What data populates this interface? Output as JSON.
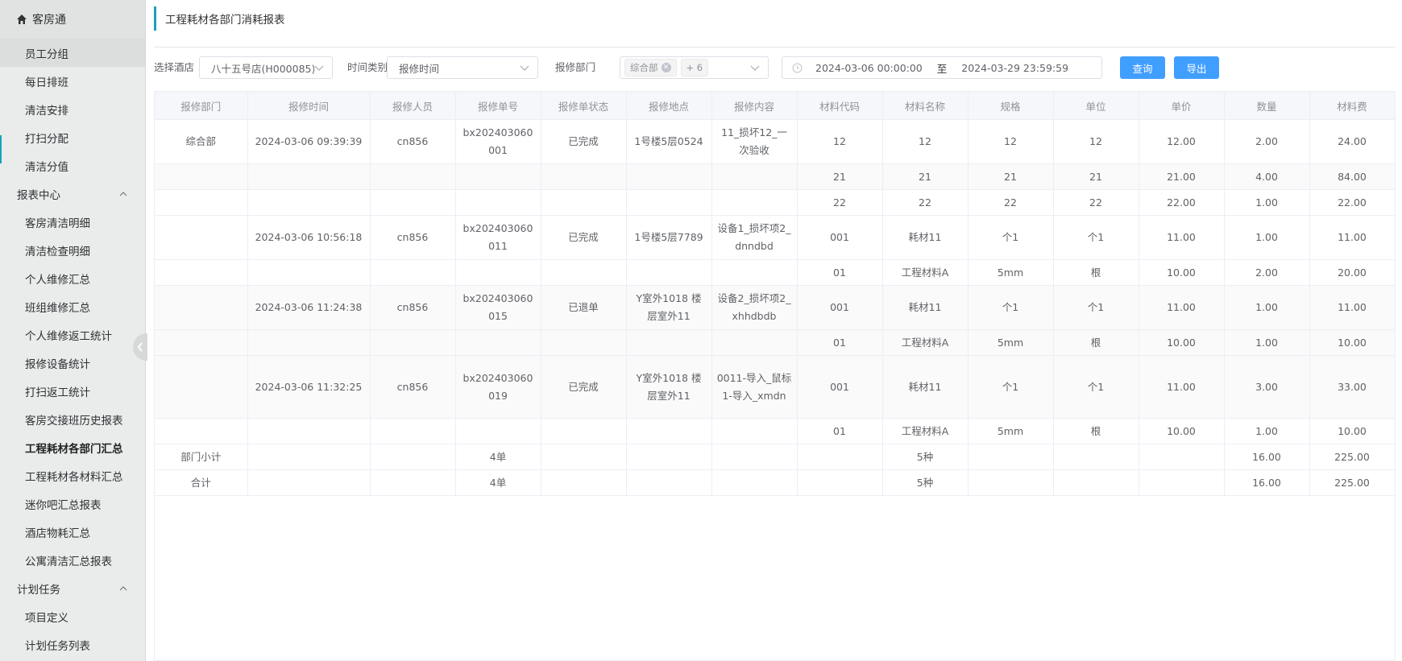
{
  "sidebar": {
    "top_label": "客房通",
    "items_top": [
      "员工分组",
      "每日排班",
      "清洁安排",
      "打扫分配",
      "清洁分值"
    ],
    "group_reports": "报表中心",
    "report_items": [
      "客房清洁明细",
      "清洁检查明细",
      "个人维修汇总",
      "班组维修汇总",
      "个人维修返工统计",
      "报修设备统计",
      "打扫返工统计",
      "客房交接班历史报表",
      "工程耗材各部门汇总",
      "工程耗材各材料汇总",
      "迷你吧汇总报表",
      "酒店物耗汇总",
      "公寓清洁汇总报表"
    ],
    "group_tasks": "计划任务",
    "task_items": [
      "项目定义",
      "计划任务列表"
    ]
  },
  "page": {
    "title": "工程耗材各部门消耗报表"
  },
  "filters": {
    "hotel_label": "选择酒店",
    "hotel_value": "八十五号店(H000085)",
    "time_type_label": "时间类别",
    "time_type_value": "报修时间",
    "dept_label": "报修部门",
    "dept_tag": "综合部",
    "dept_more": "+ 6",
    "date_start": "2024-03-06 00:00:00",
    "date_sep": "至",
    "date_end": "2024-03-29 23:59:59",
    "query_button": "查询",
    "export_button": "导出"
  },
  "table": {
    "columns": [
      "报修部门",
      "报修时间",
      "报修人员",
      "报修单号",
      "报修单状态",
      "报修地点",
      "报修内容",
      "材料代码",
      "材料名称",
      "规格",
      "单位",
      "单价",
      "数量",
      "材料费"
    ],
    "rows": [
      [
        "综合部",
        "2024-03-06 09:39:39",
        "cn856",
        "bx202403060001",
        "已完成",
        "1号楼5层0524",
        "11_损坏12_一次验收",
        "12",
        "12",
        "12",
        "12",
        "12.00",
        "2.00",
        "24.00"
      ],
      [
        "",
        "",
        "",
        "",
        "",
        "",
        "",
        "21",
        "21",
        "21",
        "21",
        "21.00",
        "4.00",
        "84.00"
      ],
      [
        "",
        "",
        "",
        "",
        "",
        "",
        "",
        "22",
        "22",
        "22",
        "22",
        "22.00",
        "1.00",
        "22.00"
      ],
      [
        "",
        "2024-03-06 10:56:18",
        "cn856",
        "bx202403060011",
        "已完成",
        "1号楼5层7789",
        "设备1_损坏项2_dnndbd",
        "001",
        "耗材11",
        "个1",
        "个1",
        "11.00",
        "1.00",
        "11.00"
      ],
      [
        "",
        "",
        "",
        "",
        "",
        "",
        "",
        "01",
        "工程材料A",
        "5mm",
        "根",
        "10.00",
        "2.00",
        "20.00"
      ],
      [
        "",
        "2024-03-06 11:24:38",
        "cn856",
        "bx202403060015",
        "已退单",
        "Y室外1018 楼层室外11",
        "设备2_损坏项2_xhhdbdb",
        "001",
        "耗材11",
        "个1",
        "个1",
        "11.00",
        "1.00",
        "11.00"
      ],
      [
        "",
        "",
        "",
        "",
        "",
        "",
        "",
        "01",
        "工程材料A",
        "5mm",
        "根",
        "10.00",
        "1.00",
        "10.00"
      ],
      [
        "",
        "2024-03-06 11:32:25",
        "cn856",
        "bx202403060019",
        "已完成",
        "Y室外1018 楼层室外11",
        "0011-导入_鼠标1-导入_xmdn",
        "001",
        "耗材11",
        "个1",
        "个1",
        "11.00",
        "3.00",
        "33.00"
      ],
      [
        "",
        "",
        "",
        "",
        "",
        "",
        "",
        "01",
        "工程材料A",
        "5mm",
        "根",
        "10.00",
        "1.00",
        "10.00"
      ],
      [
        "部门小计",
        "",
        "",
        "4单",
        "",
        "",
        "",
        "",
        "5种",
        "",
        "",
        "",
        "16.00",
        "225.00"
      ],
      [
        "合计",
        "",
        "",
        "4单",
        "",
        "",
        "",
        "",
        "5种",
        "",
        "",
        "",
        "16.00",
        "225.00"
      ]
    ]
  },
  "colors": {
    "accent": "#17a2b8",
    "primary": "#409eff"
  },
  "icons": {
    "home": "home-icon",
    "collapse": "chevron-left-icon",
    "clock": "clock-icon"
  }
}
